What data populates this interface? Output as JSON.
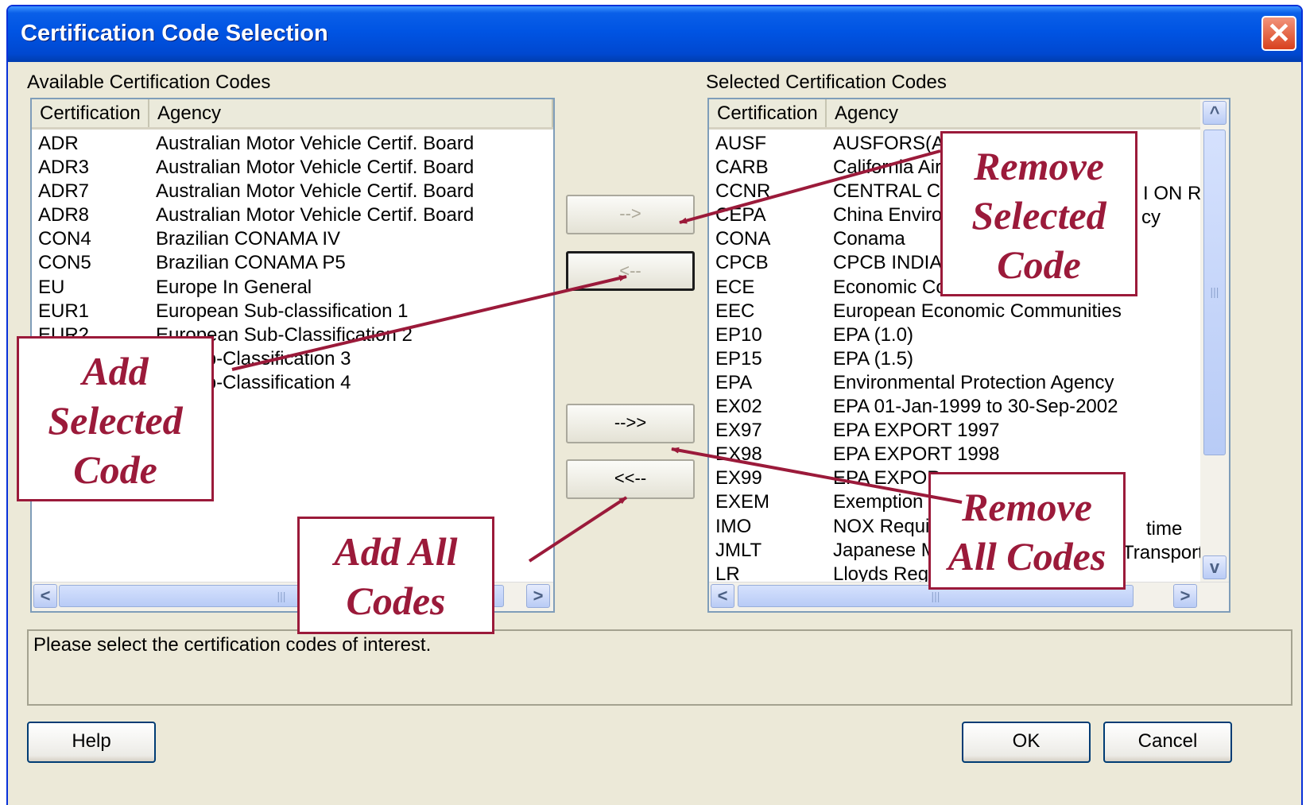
{
  "window": {
    "title": "Certification Code Selection",
    "close_label": "✕"
  },
  "available": {
    "label": "Available Certification Codes",
    "columns": [
      "Certification",
      "Agency"
    ],
    "rows": [
      [
        "ADR",
        "Australian Motor Vehicle Certif. Board"
      ],
      [
        "ADR3",
        "Australian Motor Vehicle Certif. Board"
      ],
      [
        "ADR7",
        "Australian Motor Vehicle Certif. Board"
      ],
      [
        "ADR8",
        "Australian Motor Vehicle Certif. Board"
      ],
      [
        "CON4",
        "Brazilian CONAMA IV"
      ],
      [
        "CON5",
        "Brazilian CONAMA P5"
      ],
      [
        "EU",
        "Europe In General"
      ],
      [
        "EUR1",
        "European Sub-classification 1"
      ],
      [
        "EUR2",
        "European Sub-Classification 2"
      ],
      [
        "",
        "an Sub-Classification 3"
      ],
      [
        "",
        "an Sub-Classification 4"
      ]
    ]
  },
  "selected": {
    "label": "Selected Certification Codes",
    "columns": [
      "Certification",
      "Agency"
    ],
    "rows": [
      [
        "AUSF",
        "AUSFORS(Au"
      ],
      [
        "CARB",
        "California Air R"
      ],
      [
        "CCNR",
        "CENTRAL CO"
      ],
      [
        "CEPA",
        "China Enviror"
      ],
      [
        "CONA",
        "Conama"
      ],
      [
        "CPCB",
        "CPCB INDIA"
      ],
      [
        "ECE",
        "Economic Co"
      ],
      [
        "EEC",
        "European Economic Communities"
      ],
      [
        "EP10",
        "EPA (1.0)"
      ],
      [
        "EP15",
        "EPA (1.5)"
      ],
      [
        "EPA",
        "Environmental Protection Agency"
      ],
      [
        "EX02",
        "EPA  01-Jan-1999 to 30-Sep-2002"
      ],
      [
        "EX97",
        "EPA EXPORT 1997"
      ],
      [
        "EX98",
        "EPA EXPORT 1998"
      ],
      [
        "EX99",
        "EPA EXPOR"
      ],
      [
        "EXEM",
        "Exemption S"
      ],
      [
        "IMO",
        "NOX Requir"
      ],
      [
        "JMLT",
        "Japanese M"
      ],
      [
        "LR",
        "Lloyds Regi"
      ]
    ],
    "overflow_fragments": [
      "I ON RI",
      "cy",
      "time",
      "Transport"
    ]
  },
  "buttons": {
    "add_selected": "-->",
    "remove_selected": "<--",
    "add_all": "-->>",
    "remove_all": "<<--",
    "help": "Help",
    "ok": "OK",
    "cancel": "Cancel"
  },
  "status_text": "Please select the certification codes of interest.",
  "scrollbar": {
    "thumb_grip": "|||",
    "left": "<",
    "right": ">",
    "up": "^",
    "down": "v"
  },
  "callouts": {
    "remove_selected": [
      "Remove",
      "Selected",
      "Code"
    ],
    "add_selected": [
      "Add",
      "Selected",
      "Code"
    ],
    "add_all": [
      "Add All",
      "Codes"
    ],
    "remove_all": [
      "Remove",
      "All Codes"
    ]
  },
  "colors": {
    "callout": "#9b1a3a",
    "titlebar": "#0054e3",
    "dialog_bg": "#ece9d8"
  }
}
